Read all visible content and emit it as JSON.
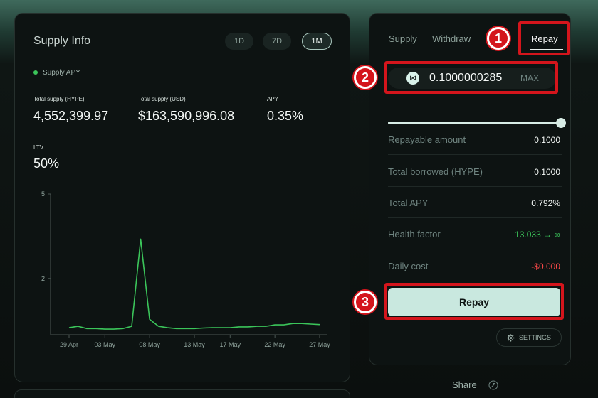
{
  "supply_info": {
    "title": "Supply Info",
    "ranges": [
      "1D",
      "7D",
      "1M"
    ],
    "active_range": "1M",
    "legend": "Supply APY",
    "legend_color": "#3bc55a",
    "stats": {
      "total_supply_hype_label": "Total supply (HYPE)",
      "total_supply_hype_value": "4,552,399.97",
      "total_supply_usd_label": "Total supply (USD)",
      "total_supply_usd_value": "$163,590,996.08",
      "apy_label": "APY",
      "apy_value": "0.35%",
      "ltv_label": "LTV",
      "ltv_value": "50%"
    }
  },
  "chart_data": {
    "type": "line",
    "x": [
      "29 Apr",
      "30 Apr",
      "1 May",
      "2 May",
      "3 May",
      "4 May",
      "5 May",
      "6 May",
      "7 May",
      "8 May",
      "9 May",
      "10 May",
      "11 May",
      "12 May",
      "13 May",
      "14 May",
      "15 May",
      "16 May",
      "17 May",
      "18 May",
      "19 May",
      "20 May",
      "21 May",
      "22 May",
      "23 May",
      "24 May",
      "25 May",
      "26 May",
      "27 May"
    ],
    "xticks": [
      "29 Apr",
      "03 May",
      "08 May",
      "13 May",
      "17 May",
      "22 May",
      "27 May"
    ],
    "yticks": [
      "5",
      "2"
    ],
    "ylim": [
      0,
      5
    ],
    "series": [
      {
        "color": "#3bc55a",
        "values": [
          0.25,
          0.3,
          0.22,
          0.22,
          0.2,
          0.2,
          0.22,
          0.3,
          3.4,
          0.55,
          0.3,
          0.25,
          0.22,
          0.22,
          0.22,
          0.24,
          0.25,
          0.25,
          0.25,
          0.28,
          0.28,
          0.3,
          0.3,
          0.35,
          0.35,
          0.4,
          0.4,
          0.38,
          0.36
        ]
      }
    ],
    "grid": false
  },
  "repay_panel": {
    "tabs": [
      "Supply",
      "Withdraw",
      "Repay"
    ],
    "active_tab": "Repay",
    "amount_value": "0.1000000285",
    "max_label": "MAX",
    "slider_fraction": 1.0,
    "rows": [
      {
        "label": "Repayable amount",
        "value": "0.1000",
        "color": "#f4f8f6"
      },
      {
        "label": "Total borrowed (HYPE)",
        "value": "0.1000",
        "color": "#f4f8f6"
      },
      {
        "label": "Total APY",
        "value": "0.792%",
        "color": "#f4f8f6"
      },
      {
        "label": "Health factor",
        "value": "13.033 → ∞",
        "color": "#3bc55a"
      },
      {
        "label": "Daily cost",
        "value": "-$0.000",
        "color": "#ff4a4a"
      }
    ],
    "repay_button": "Repay",
    "settings_label": "SETTINGS"
  },
  "share_label": "Share",
  "annotations": [
    "1",
    "2",
    "3"
  ],
  "colors": {
    "accent": "#c9e8df",
    "highlight": "#d4151c"
  }
}
